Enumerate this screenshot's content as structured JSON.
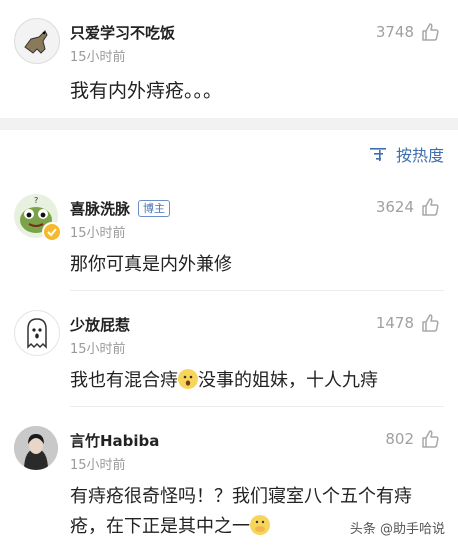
{
  "top_comment": {
    "username": "只爱学习不吃饭",
    "time": "15小时前",
    "likes": "3748",
    "text": "我有内外痔疮。。。"
  },
  "sort": {
    "label": "按热度",
    "icon": "sort-lines-icon"
  },
  "comments": [
    {
      "username": "喜脉洗脉",
      "badge": "博主",
      "time": "15小时前",
      "likes": "3624",
      "text": "那你可真是内外兼修"
    },
    {
      "username": "少放屁惹",
      "time": "15小时前",
      "likes": "1478",
      "text_before": "我也有混合痔",
      "emoji": "fearful-face-emoji",
      "text_after": "没事的姐妹，十人九痔"
    },
    {
      "username": "言竹Habiba",
      "time": "15小时前",
      "likes": "802",
      "text": "有痔疮很奇怪吗！？我们寝室八个五个有痔疮，在下正是其中之一",
      "emoji": "hand-over-mouth-emoji"
    }
  ],
  "watermark": "头条 @助手哈说",
  "colors": {
    "link_blue": "#3f6fb0",
    "muted_gray": "#9a9a9a",
    "separator": "#f2f2f2"
  }
}
